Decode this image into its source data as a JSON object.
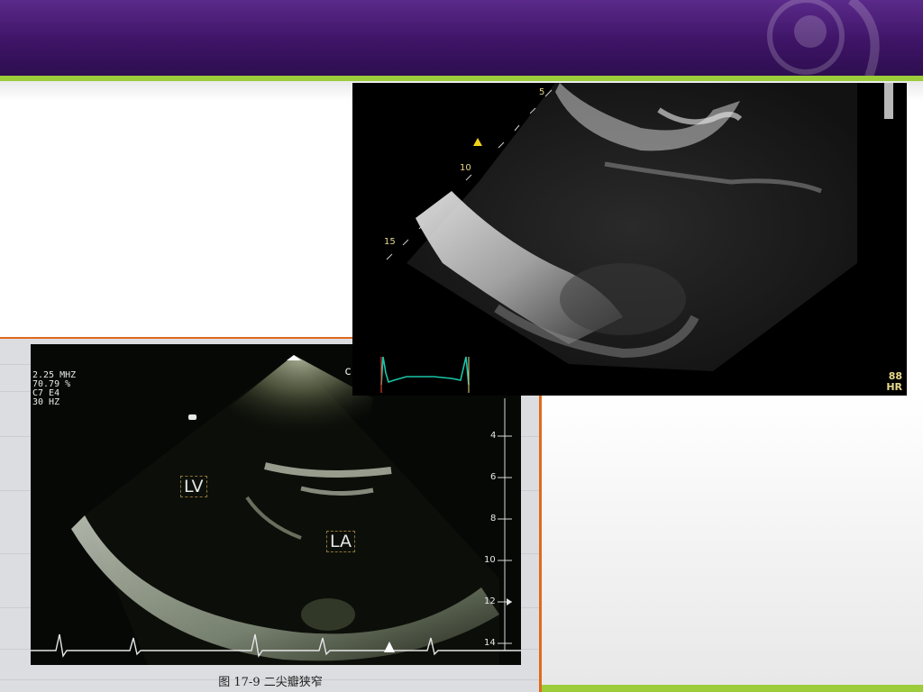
{
  "slide": {
    "colors": {
      "header": "#3e1466",
      "accent_line": "#9ccc3a",
      "photo_border": "#e06a1a"
    }
  },
  "echo_top": {
    "depth_markers": [
      "5",
      "10",
      "15"
    ],
    "heart_rate_value": "88",
    "heart_rate_label": "HR"
  },
  "echo_book": {
    "scan_params": [
      "2.25 MHZ",
      "70.79 %",
      "C7 E4",
      "30 HZ"
    ],
    "corner_mark": "c",
    "labels": {
      "left_ventricle": "LV",
      "left_atrium": "LA"
    },
    "depth_scale": [
      "4",
      "6",
      "8",
      "10",
      "12",
      "14"
    ],
    "caption": "图 17-9   二尖瓣狭窄"
  }
}
